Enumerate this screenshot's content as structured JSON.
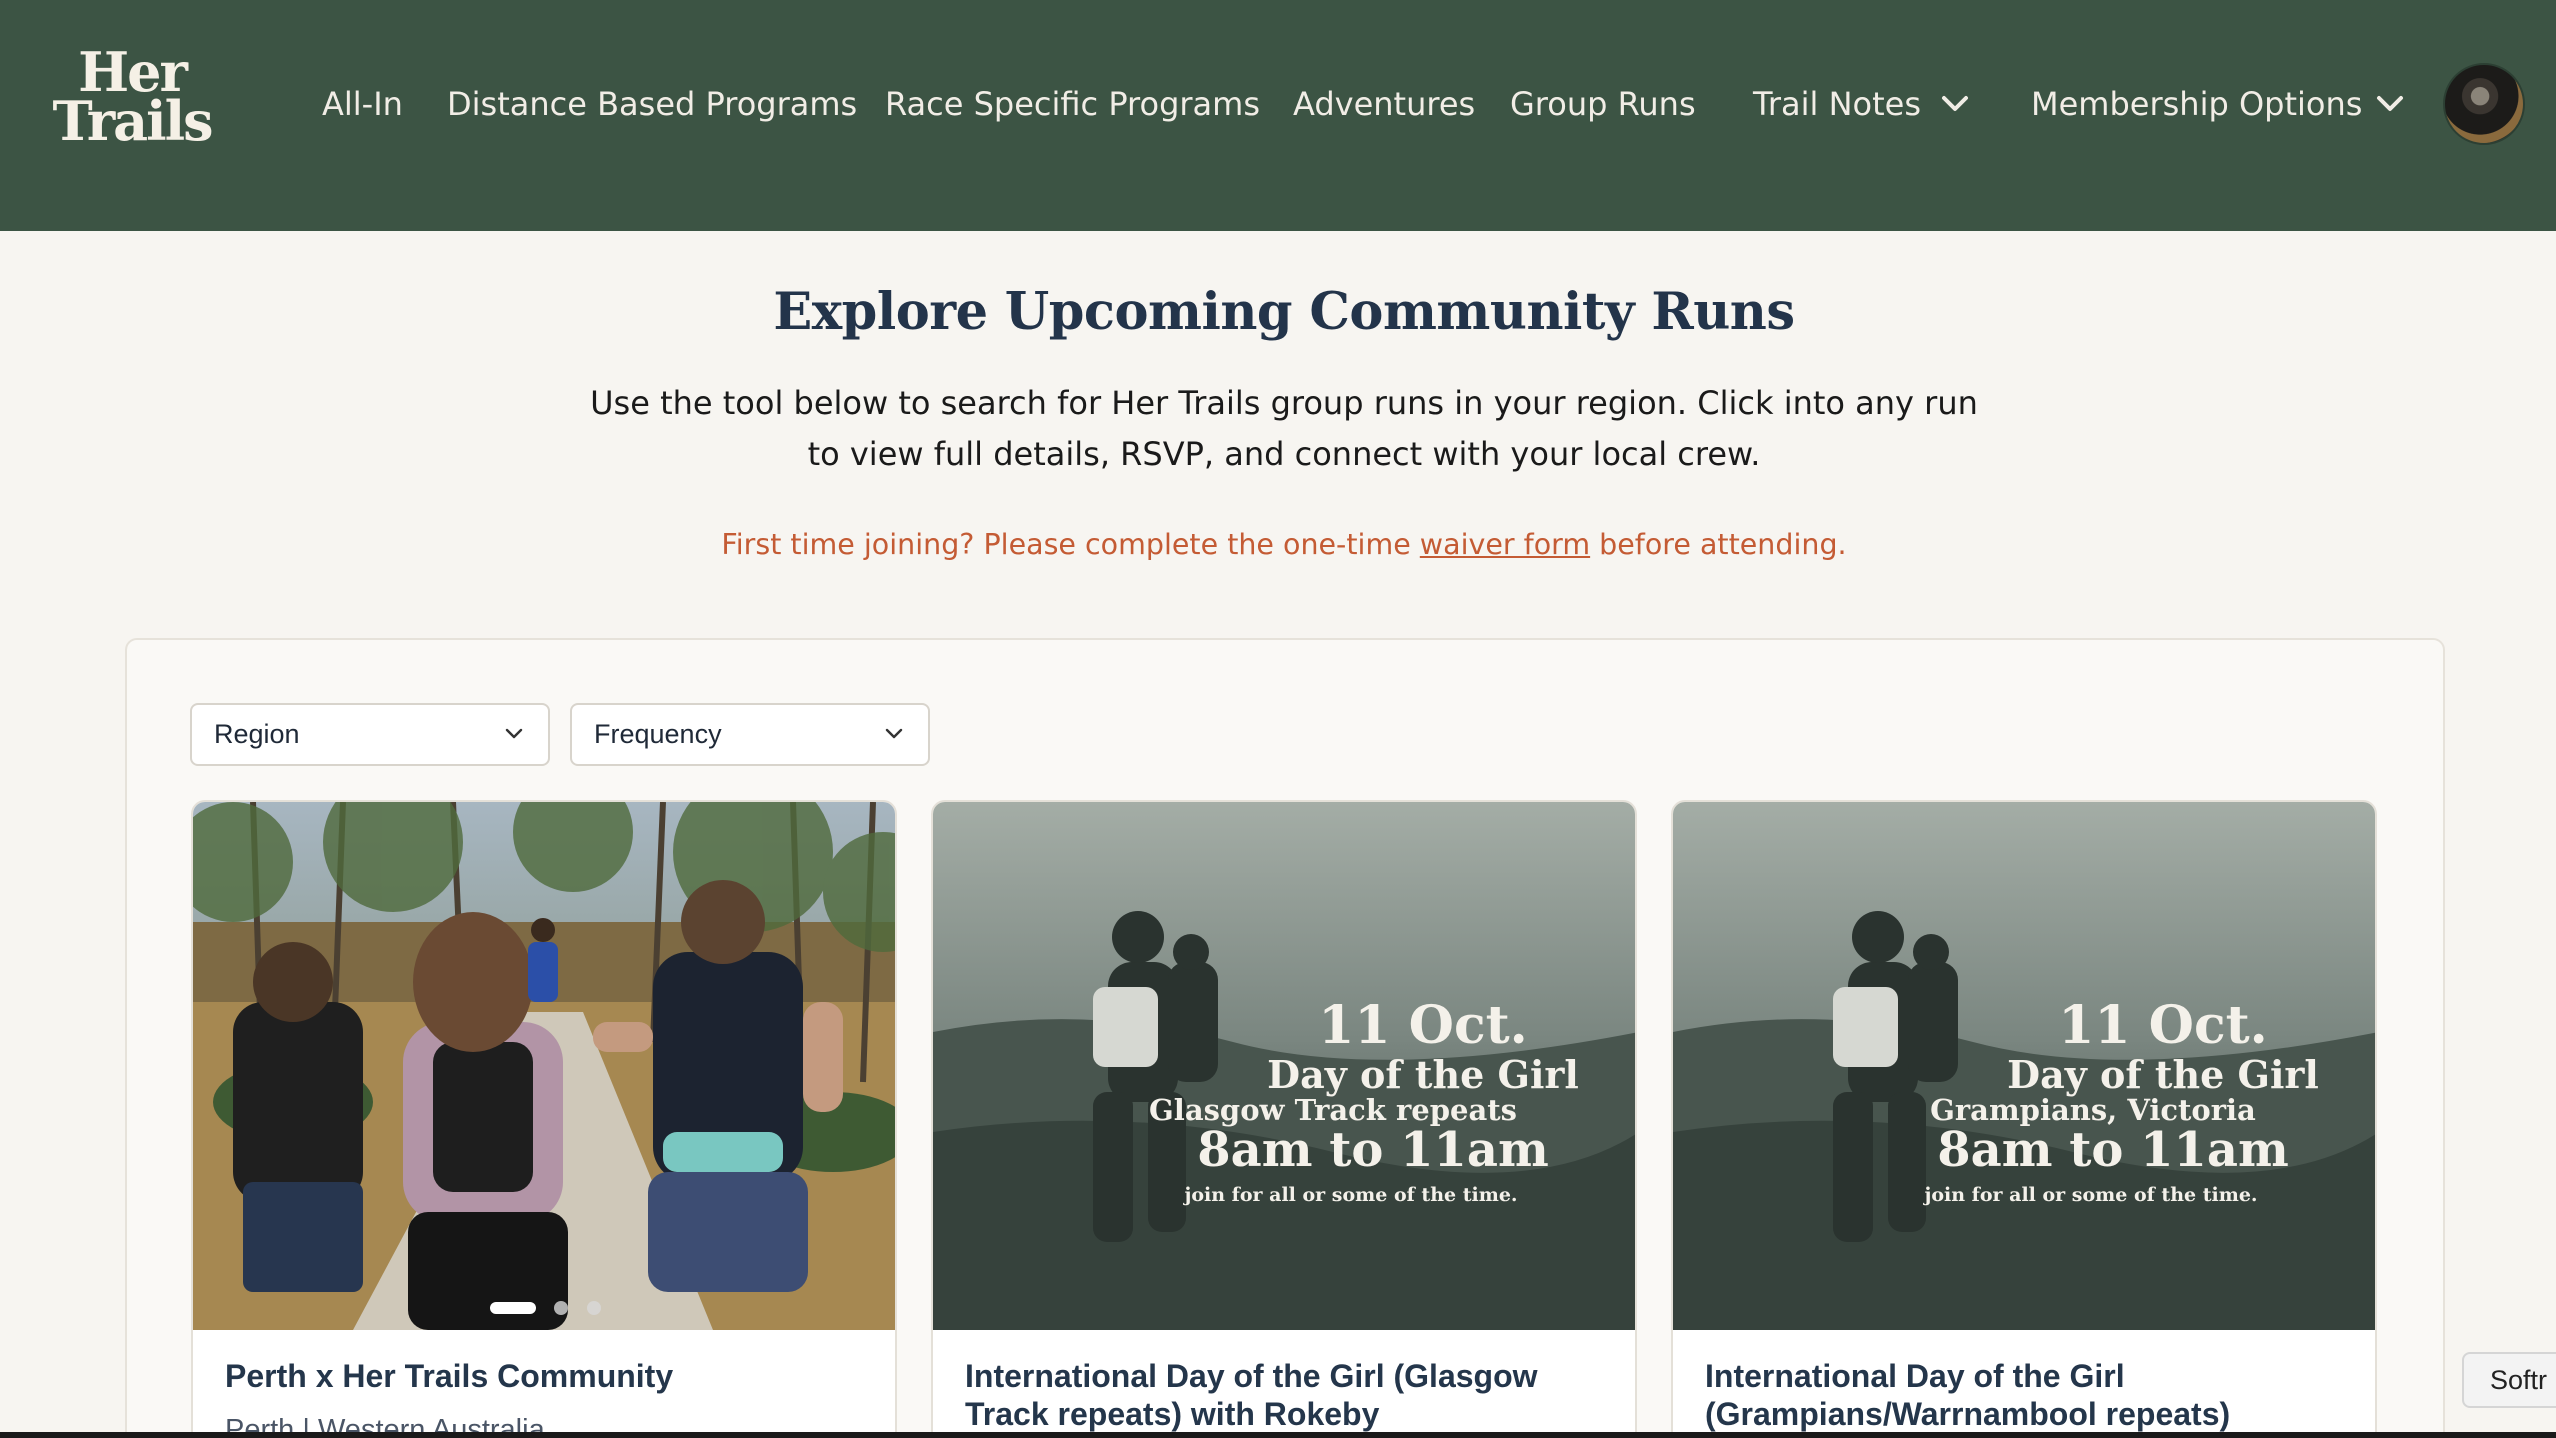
{
  "brand": {
    "logo_line1": "Her",
    "logo_line2": "Trails"
  },
  "nav": {
    "items": [
      {
        "label": "All-In"
      },
      {
        "label": "Distance Based Programs"
      },
      {
        "label": "Race Specific Programs"
      },
      {
        "label": "Adventures"
      },
      {
        "label": "Group Runs"
      },
      {
        "label": "Trail Notes"
      },
      {
        "label": "Membership Options"
      }
    ]
  },
  "intro": {
    "title": "Explore Upcoming Community Runs",
    "line1": "Use the tool below to search for Her Trails group runs in your region. Click into any run",
    "line2": "to view full details, RSVP, and connect with your local crew.",
    "waiver_before": "First time joining? Please complete the one-time ",
    "waiver_link": "waiver form",
    "waiver_after": " before attending."
  },
  "filters": {
    "region": "Region",
    "frequency": "Frequency"
  },
  "cards": [
    {
      "title": "Perth x Her Trails Community",
      "subtitle": "Perth | Western Australia"
    },
    {
      "title": "International Day of the Girl (Glasgow Track repeats) with Rokeby",
      "poster": {
        "date": "11 Oct.",
        "event": "Day of the Girl",
        "location": "Glasgow Track repeats",
        "time": "8am to 11am",
        "note": "join for all or some of the time."
      }
    },
    {
      "title": "International Day of the Girl (Grampians/Warrnambool repeats)",
      "poster": {
        "date": "11 Oct.",
        "event": "Day of the Girl",
        "location": "Grampians, Victoria",
        "time": "8am to 11am",
        "note": "join for all or some of the time."
      }
    }
  ],
  "carousel": {
    "slide_count": 3,
    "active_index": 0
  },
  "softr_badge": "Softr",
  "colors": {
    "header_bg": "#3c5444",
    "accent": "#c45b34",
    "page_bg": "#f7f5f1"
  }
}
